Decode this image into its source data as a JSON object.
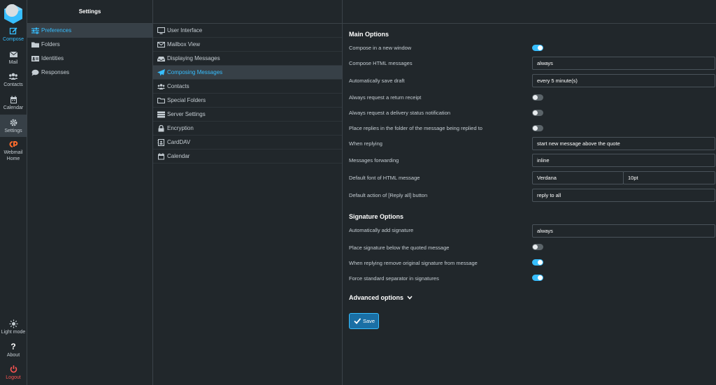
{
  "nav": {
    "compose": "Compose",
    "mail": "Mail",
    "contacts": "Contacts",
    "calendar": "Calendar",
    "settings": "Settings",
    "webmail_home": "Webmail Home",
    "light_mode": "Light mode",
    "about": "About",
    "logout": "Logout"
  },
  "settings_column": {
    "title": "Settings",
    "items": [
      {
        "label": "Preferences",
        "icon": "sliders-icon"
      },
      {
        "label": "Folders",
        "icon": "folder-icon"
      },
      {
        "label": "Identities",
        "icon": "id-card-icon"
      },
      {
        "label": "Responses",
        "icon": "comment-icon"
      }
    ]
  },
  "sections_column": {
    "items": [
      {
        "label": "User Interface",
        "icon": "monitor-icon"
      },
      {
        "label": "Mailbox View",
        "icon": "envelope-icon"
      },
      {
        "label": "Displaying Messages",
        "icon": "inbox-icon"
      },
      {
        "label": "Composing Messages",
        "icon": "paper-plane-icon"
      },
      {
        "label": "Contacts",
        "icon": "users-icon"
      },
      {
        "label": "Special Folders",
        "icon": "folder-outline-icon"
      },
      {
        "label": "Server Settings",
        "icon": "server-icon"
      },
      {
        "label": "Encryption",
        "icon": "lock-icon"
      },
      {
        "label": "CardDAV",
        "icon": "address-card-icon"
      },
      {
        "label": "Calendar",
        "icon": "calendar-icon"
      }
    ]
  },
  "main": {
    "main_options_title": "Main Options",
    "compose_new_window": "Compose in a new window",
    "compose_html": "Compose HTML messages",
    "compose_html_value": "always",
    "auto_save_draft": "Automatically save draft",
    "auto_save_draft_value": "every 5 minute(s)",
    "return_receipt": "Always request a return receipt",
    "delivery_status": "Always request a delivery status notification",
    "place_replies": "Place replies in the folder of the message being replied to",
    "when_replying": "When replying",
    "when_replying_value": "start new message above the quote",
    "messages_forwarding": "Messages forwarding",
    "messages_forwarding_value": "inline",
    "default_font": "Default font of HTML message",
    "default_font_value": "Verdana",
    "default_font_size_value": "10pt",
    "default_reply_all": "Default action of [Reply all] button",
    "default_reply_all_value": "reply to all",
    "signature_options_title": "Signature Options",
    "auto_add_signature": "Automatically add signature",
    "auto_add_signature_value": "always",
    "sig_below_quote": "Place signature below the quoted message",
    "remove_orig_sig": "When replying remove original signature from message",
    "force_separator": "Force standard separator in signatures",
    "advanced_options": "Advanced options",
    "save": "Save"
  },
  "colors": {
    "accent": "#37beff",
    "background": "#21272b",
    "logout": "#ff5552"
  }
}
